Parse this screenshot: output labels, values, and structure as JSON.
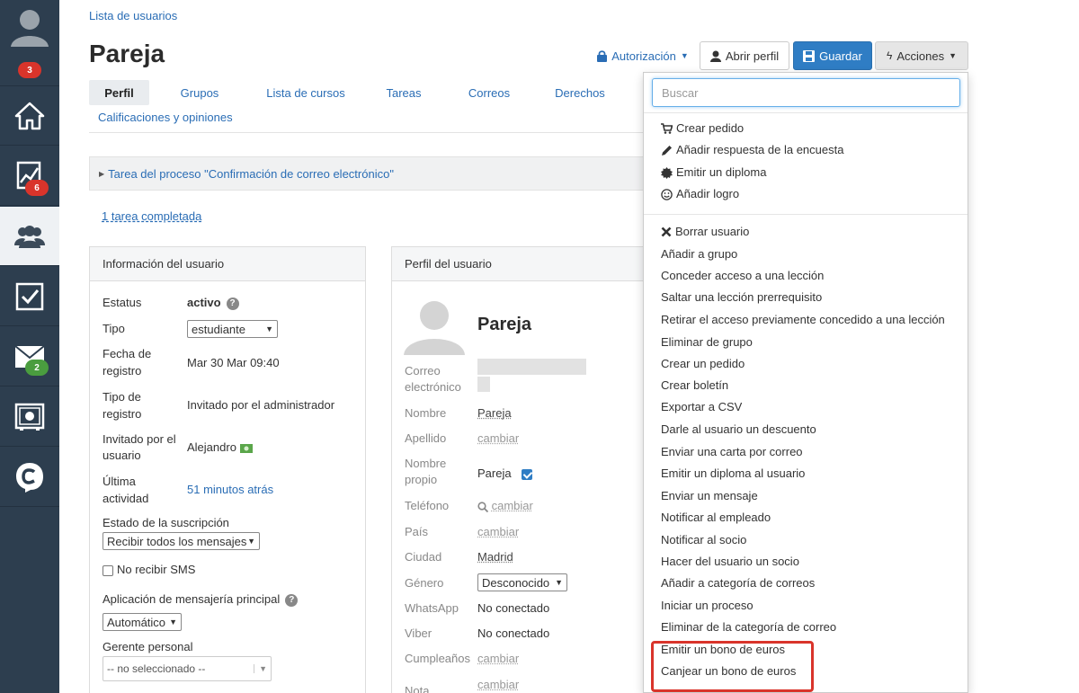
{
  "sidebar": {
    "badges": {
      "avatar": "3",
      "stats": "6",
      "mail": "2"
    }
  },
  "breadcrumb": "Lista de usuarios",
  "title": "Pareja",
  "header": {
    "auth_label": "Autorización",
    "open_profile_label": "Abrir perfil",
    "save_label": "Guardar",
    "actions_label": "Acciones"
  },
  "tabs": [
    "Perfil",
    "Grupos",
    "Lista de cursos",
    "Tareas",
    "Correos",
    "Derechos",
    "Calificaciones y opiniones"
  ],
  "process": {
    "title": "Tarea del proceso \"Confirmación de correo electrónico\"",
    "completed": "1 tarea completada"
  },
  "user_info": {
    "heading": "Información del usuario",
    "status_label": "Estatus",
    "status_value": "activo",
    "type_label": "Tipo",
    "type_value": "estudiante",
    "reg_date_label_1": "Fecha de",
    "reg_date_label_2": "registro",
    "reg_date_value": "Mar 30 Mar 09:40",
    "reg_type_label_1": "Tipo de",
    "reg_type_label_2": "registro",
    "reg_type_value": "Invitado por el administrador",
    "invited_label_1": "Invitado por el",
    "invited_label_2": "usuario",
    "invited_value": "Alejandro",
    "last_activity_label_1": "Última",
    "last_activity_label_2": "actividad",
    "last_activity_value": "51 minutos atrás",
    "subscription_label": "Estado de la suscripción",
    "subscription_value": "Recibir todos los mensajes",
    "no_sms_label": "No recibir SMS",
    "messenger_label": "Aplicación de mensajería principal",
    "messenger_value": "Automático",
    "manager_label": "Gerente personal",
    "manager_value": "-- no seleccionado --"
  },
  "profile": {
    "heading": "Perfil del usuario",
    "name": "Pareja",
    "email_label_1": "Correo",
    "email_label_2": "electrónico",
    "first_name_label": "Nombre",
    "first_name_value": "Pareja",
    "last_name_label": "Apellido",
    "change": "cambiar",
    "own_name_label_1": "Nombre",
    "own_name_label_2": "propio",
    "own_name_value": "Pareja",
    "phone_label": "Teléfono",
    "country_label": "País",
    "city_label": "Ciudad",
    "city_value": "Madrid",
    "gender_label": "Género",
    "gender_value": "Desconocido",
    "whatsapp_label": "WhatsApp",
    "whatsapp_value": "No conectado",
    "viber_label": "Viber",
    "viber_value": "No conectado",
    "birthday_label": "Cumpleaños",
    "note_label": "Nota"
  },
  "dropdown": {
    "search_placeholder": "Buscar",
    "group1": [
      "Crear pedido",
      "Añadir respuesta de la encuesta",
      "Emitir un diploma",
      "Añadir logro"
    ],
    "group2": [
      "Borrar usuario",
      "Añadir a grupo",
      "Conceder acceso a una lección",
      "Saltar una lección prerrequisito",
      "Retirar el acceso previamente concedido a una lección",
      "Eliminar de grupo",
      "Crear un pedido",
      "Crear boletín",
      "Exportar a CSV",
      "Darle al usuario un descuento",
      "Enviar una carta por correo",
      "Emitir un diploma al usuario",
      "Enviar un mensaje",
      "Notificar al empleado",
      "Notificar al socio",
      "Hacer del usuario un socio",
      "Añadir a categoría de correos",
      "Iniciar un proceso",
      "Eliminar de la categoría de correo",
      "Emitir un bono de euros",
      "Canjear un bono de euros"
    ]
  },
  "colors": {
    "sidebar": "#2d3e4f",
    "link": "#2a6db5",
    "primary": "#2f7dc4",
    "highlight": "#d9342b"
  }
}
